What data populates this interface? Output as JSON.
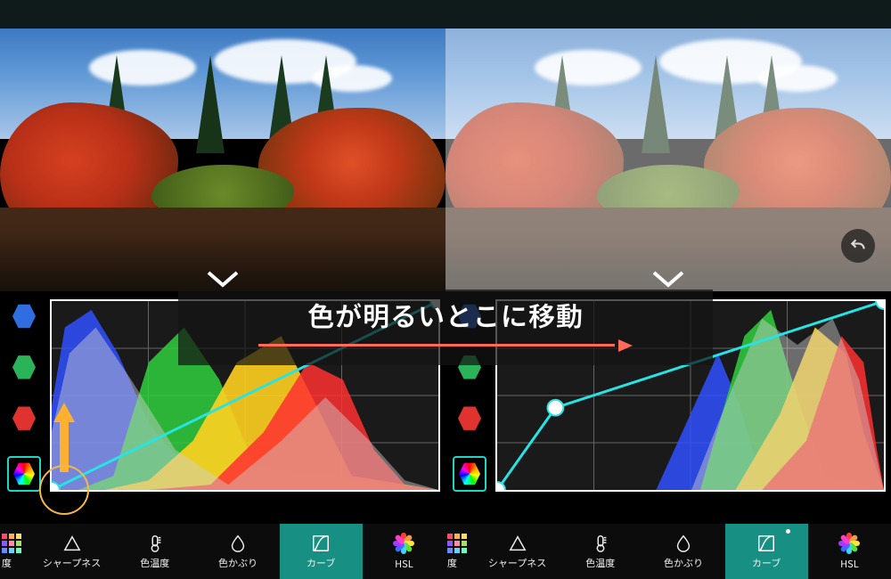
{
  "annotation": {
    "text": "色が明るいとこに移動"
  },
  "channels": {
    "blue": "blue",
    "green": "green",
    "red": "red",
    "rgb": "rgb"
  },
  "toolbar": {
    "items": [
      {
        "id": "saturation-partial",
        "label": "度"
      },
      {
        "id": "sharpness",
        "label": "シャープネス"
      },
      {
        "id": "temperature",
        "label": "色温度"
      },
      {
        "id": "tint",
        "label": "色かぶり"
      },
      {
        "id": "curves",
        "label": "カーブ",
        "active": true
      },
      {
        "id": "hsl",
        "label": "HSL"
      }
    ]
  },
  "curves": {
    "left": {
      "points": [
        [
          0,
          216
        ],
        [
          438,
          0
        ]
      ]
    },
    "right": {
      "points": [
        [
          0,
          216
        ],
        [
          66,
          122
        ],
        [
          438,
          0
        ]
      ]
    }
  },
  "colors": {
    "accent": "#178f83",
    "curve": "#27e4e4",
    "arrow": "#ff6a5a",
    "upArrow": "#ffb030",
    "ring": "#f5b74a"
  }
}
